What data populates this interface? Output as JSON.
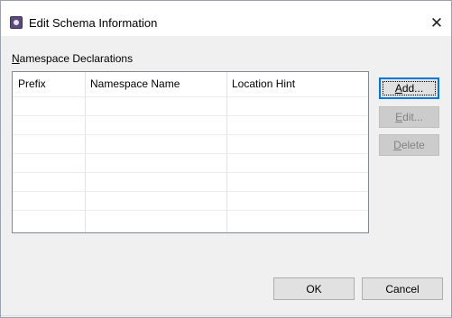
{
  "window": {
    "title": "Edit Schema Information",
    "app_icon": "eclipse-app-icon",
    "close_glyph": "✕"
  },
  "section": {
    "label": "Namespace Declarations"
  },
  "table": {
    "columns": [
      "Prefix",
      "Namespace Name",
      "Location Hint"
    ],
    "rows": [],
    "empty_row_count": 7
  },
  "side_buttons": {
    "add": "Add...",
    "edit": "Edit...",
    "delete": "Delete"
  },
  "footer": {
    "ok": "OK",
    "cancel": "Cancel"
  },
  "colors": {
    "focus_accent": "#0078d7",
    "dialog_background": "#f0f0f0"
  }
}
